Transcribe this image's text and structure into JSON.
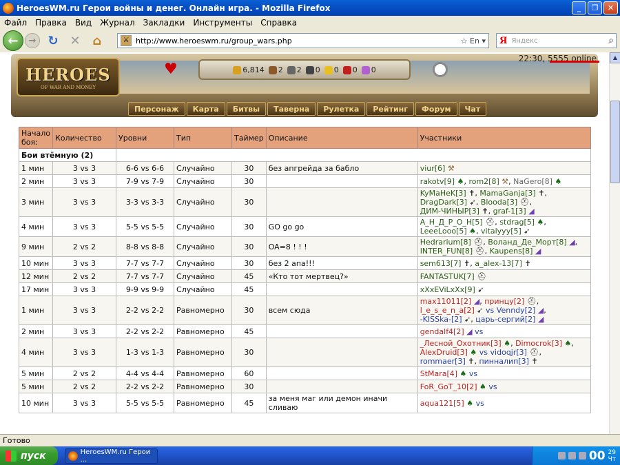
{
  "window": {
    "title": "HeroesWM.ru Герои войны и денег. Онлайн игра. - Mozilla Firefox"
  },
  "menu": [
    "Файл",
    "Правка",
    "Вид",
    "Журнал",
    "Закладки",
    "Инструменты",
    "Справка"
  ],
  "browser": {
    "url": "http://www.heroeswm.ru/group_wars.php",
    "search_placeholder": "Яндекс",
    "lang": "En",
    "search_logo": "Я",
    "status": "Готово"
  },
  "header": {
    "logo_title": "HEROES",
    "logo_subtitle": "OF WAR AND MONEY",
    "time": "22:30,",
    "online": "5555 online",
    "resources": [
      {
        "icon": "gold-icon",
        "value": "6,814",
        "color": "#d8a020"
      },
      {
        "icon": "wood-icon",
        "value": "2",
        "color": "#8a5a2a"
      },
      {
        "icon": "ore-icon",
        "value": "2",
        "color": "#666666"
      },
      {
        "icon": "mercury-icon",
        "value": "0",
        "color": "#444444"
      },
      {
        "icon": "sulfur-icon",
        "value": "0",
        "color": "#e8c020"
      },
      {
        "icon": "crystal-icon",
        "value": "0",
        "color": "#c02020"
      },
      {
        "icon": "gems-icon",
        "value": "0",
        "color": "#b060d0"
      }
    ],
    "nav": [
      "Персонаж",
      "Карта",
      "Битвы",
      "Таверна",
      "Рулетка",
      "Рейтинг",
      "Форум",
      "Чат"
    ]
  },
  "table": {
    "headers": [
      "Начало боя:",
      "Количество",
      "Уровни",
      "Тип",
      "Таймер",
      "Описание",
      "Участники"
    ],
    "group_title": "Бои втёмную (2)",
    "rows": [
      {
        "start": "1 мин",
        "count": "3 vs 3",
        "levels": "6-6 vs 6-6",
        "type": "Случайно",
        "timer": "30",
        "desc": "без апгрейда за бабло",
        "participants": [
          [
            [
              "viur[6]",
              "pl",
              "axe"
            ]
          ]
        ]
      },
      {
        "start": "2 мин",
        "count": "3 vs 3",
        "levels": "7-9 vs 7-9",
        "type": "Случайно",
        "timer": "30",
        "desc": "",
        "participants": [
          [
            [
              "rakotv[9]",
              "pl",
              "leaf"
            ],
            [
              "rom2[8]",
              "pl",
              "axe"
            ],
            [
              "NaGero[8]",
              "pg",
              "leaf"
            ]
          ]
        ]
      },
      {
        "start": "3 мин",
        "count": "3 vs 3",
        "levels": "3-3 vs 3-3",
        "type": "Случайно",
        "timer": "30",
        "desc": "",
        "participants": [
          [
            [
              "KyMaHeK[3]",
              "pl",
              "cross"
            ],
            [
              "MamaGanja[3]",
              "pl",
              "cross"
            ]
          ],
          [
            [
              "DragDark[3]",
              "pl",
              "bow"
            ],
            [
              "Blooda[3]",
              "pl",
              "helm"
            ]
          ],
          [
            [
              "ДИМ-ЧИНЫР[3]",
              "pl",
              "cross"
            ],
            [
              "graf-1[3]",
              "pl",
              "hat"
            ]
          ]
        ]
      },
      {
        "start": "4 мин",
        "count": "3 vs 3",
        "levels": "5-5 vs 5-5",
        "type": "Случайно",
        "timer": "30",
        "desc": "GO go go",
        "participants": [
          [
            [
              "А_Н_Д_Р_О_Н[5]",
              "pl",
              "helm"
            ],
            [
              "stdrag[5]",
              "pl",
              "leaf"
            ]
          ],
          [
            [
              "LeeeLooo[5]",
              "pl",
              "leaf"
            ],
            [
              "vitalyyy[5]",
              "pl",
              "bow"
            ]
          ]
        ]
      },
      {
        "start": "9 мин",
        "count": "2 vs 2",
        "levels": "8-8 vs 8-8",
        "type": "Случайно",
        "timer": "30",
        "desc": "OA=8 ! ! !",
        "participants": [
          [
            [
              "Hedrarium[8]",
              "pl",
              "helm"
            ],
            [
              "Воланд_Де_Морт[8]",
              "pl",
              "hat"
            ]
          ],
          [
            [
              "INTER_FUN[8]",
              "pl",
              "helm"
            ],
            [
              "Kaupens[8]",
              "pl",
              "hat"
            ]
          ]
        ]
      },
      {
        "start": "10 мин",
        "count": "3 vs 3",
        "levels": "7-7 vs 7-7",
        "type": "Случайно",
        "timer": "30",
        "desc": "без 2 апа!!!",
        "participants": [
          [
            [
              "sem613[7]",
              "pl",
              "cross"
            ],
            [
              "a_alex-13[7]",
              "pl",
              "cross"
            ]
          ]
        ]
      },
      {
        "start": "12 мин",
        "count": "2 vs 2",
        "levels": "7-7 vs 7-7",
        "type": "Случайно",
        "timer": "45",
        "desc": "«Кто тот мертвец?»",
        "participants": [
          [
            [
              "FANTASTUK[7]",
              "pl",
              "helm"
            ]
          ]
        ]
      },
      {
        "start": "17 мин",
        "count": "3 vs 3",
        "levels": "9-9 vs 9-9",
        "type": "Случайно",
        "timer": "45",
        "desc": "",
        "participants": [
          [
            [
              "xXxEViLxXx[9]",
              "pl",
              "bow"
            ]
          ]
        ]
      },
      {
        "start": "1 мин",
        "count": "3 vs 3",
        "levels": "2-2 vs 2-2",
        "type": "Равномерно",
        "timer": "30",
        "desc": "всем сюда",
        "participants": [
          [
            [
              "max11011[2]",
              "pr",
              "hat"
            ],
            [
              "принцу[2]",
              "pr",
              "helm"
            ]
          ],
          [
            [
              "l_e_s_e_n_a[2]",
              "pr",
              "bow"
            ],
            [
              "vs",
              "",
              " "
            ],
            [
              "Venndy[2]",
              "pb",
              "hat"
            ]
          ],
          [
            [
              "-KISSka-[2]",
              "pb",
              "bow"
            ],
            [
              "царь-сергий[2]",
              "pb",
              "hat"
            ]
          ]
        ]
      },
      {
        "start": "2 мин",
        "count": "3 vs 3",
        "levels": "2-2 vs 2-2",
        "type": "Равномерно",
        "timer": "45",
        "desc": "",
        "participants": [
          [
            [
              "gendalf4[2]",
              "pr",
              "hat"
            ],
            [
              "vs",
              "",
              " "
            ]
          ]
        ]
      },
      {
        "start": "4 мин",
        "count": "3 vs 3",
        "levels": "1-3 vs 1-3",
        "type": "Равномерно",
        "timer": "30",
        "desc": "",
        "participants": [
          [
            [
              "_Лесной_Охотник[3]",
              "pr",
              "leaf"
            ],
            [
              "Dimocrok[3]",
              "pr",
              "leaf"
            ]
          ],
          [
            [
              "AlexDruid[3]",
              "pr",
              "leaf"
            ],
            [
              "vs",
              "",
              " "
            ],
            [
              "vidoqjr[3]",
              "pb",
              "helm"
            ]
          ],
          [
            [
              "rommaer[3]",
              "pb",
              "cross"
            ],
            [
              "пинналип[3]",
              "pb",
              "cross"
            ]
          ]
        ]
      },
      {
        "start": "5 мин",
        "count": "2 vs 2",
        "levels": "4-4 vs 4-4",
        "type": "Равномерно",
        "timer": "60",
        "desc": "",
        "participants": [
          [
            [
              "StMara[4]",
              "pr",
              "leaf"
            ],
            [
              "vs",
              "",
              " "
            ]
          ]
        ]
      },
      {
        "start": "5 мин",
        "count": "2 vs 2",
        "levels": "2-2 vs 2-2",
        "type": "Равномерно",
        "timer": "30",
        "desc": "",
        "participants": [
          [
            [
              "FoR_GoT_10[2]",
              "pr",
              "leaf"
            ],
            [
              "vs",
              "",
              " "
            ]
          ]
        ]
      },
      {
        "start": "10 мин",
        "count": "3 vs 3",
        "levels": "5-5 vs 5-5",
        "type": "Равномерно",
        "timer": "45",
        "desc": "за меня маг или демон иначи сливаю",
        "participants": [
          [
            [
              "aqua121[5]",
              "pr",
              "leaf"
            ],
            [
              "vs",
              "",
              " "
            ]
          ]
        ]
      }
    ]
  },
  "taskbar": {
    "start": "пуск",
    "task": "HeroesWM.ru Герои ...",
    "clock": "00",
    "clock_small_1": "29",
    "clock_small_2": "Чт"
  }
}
